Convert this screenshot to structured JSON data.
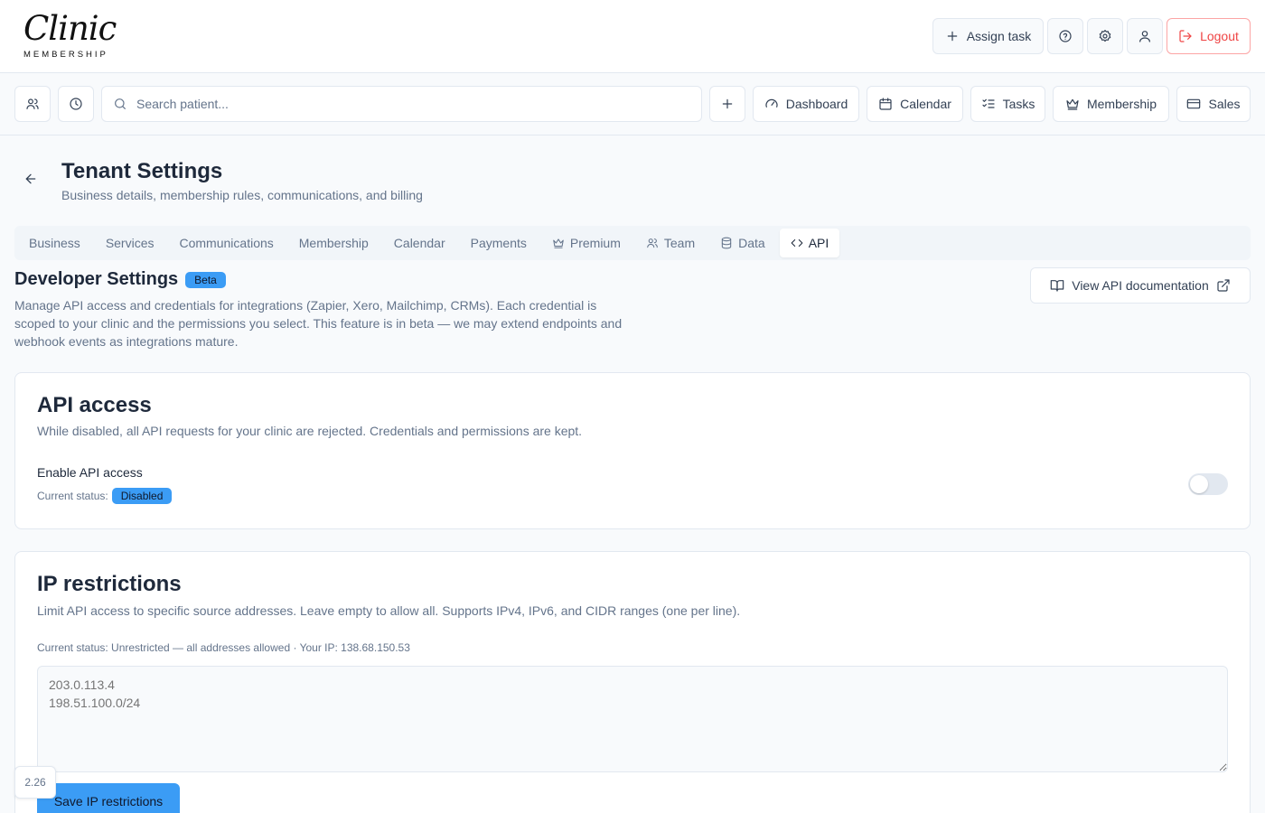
{
  "brand": {
    "logo_script": "Clinic",
    "logo_sub": "MEMBERSHIP"
  },
  "header": {
    "assign_task": "Assign task",
    "logout": "Logout",
    "icons": [
      "help-icon",
      "gear-icon",
      "user-icon",
      "logout-icon"
    ]
  },
  "nav": {
    "search_placeholder": "Search patient...",
    "items": [
      {
        "label": "Dashboard",
        "icon": "gauge-icon"
      },
      {
        "label": "Calendar",
        "icon": "calendar-icon"
      },
      {
        "label": "Tasks",
        "icon": "list-checks-icon"
      },
      {
        "label": "Membership",
        "icon": "crown-icon"
      },
      {
        "label": "Sales",
        "icon": "credit-card-icon"
      }
    ]
  },
  "page": {
    "title": "Tenant Settings",
    "subtitle": "Business details, membership rules, communications, and billing"
  },
  "tabs": [
    {
      "label": "Business"
    },
    {
      "label": "Services"
    },
    {
      "label": "Communications"
    },
    {
      "label": "Membership"
    },
    {
      "label": "Calendar"
    },
    {
      "label": "Payments"
    },
    {
      "label": "Premium",
      "icon": "crown-icon"
    },
    {
      "label": "Team",
      "icon": "users-icon"
    },
    {
      "label": "Data",
      "icon": "database-icon"
    },
    {
      "label": "API",
      "icon": "code-icon",
      "active": true
    }
  ],
  "developer": {
    "title": "Developer Settings",
    "badge": "Beta",
    "description": "Manage API access and credentials for integrations (Zapier, Xero, Mailchimp, CRMs). Each credential is scoped to your clinic and the permissions you select. This feature is in beta — we may extend endpoints and webhook events as integrations mature.",
    "doc_button": "View API documentation"
  },
  "api_access": {
    "title": "API access",
    "description": "While disabled, all API requests for your clinic are rejected. Credentials and permissions are kept.",
    "enable_label": "Enable API access",
    "status_label": "Current status:",
    "status_value": "Disabled",
    "enabled": false
  },
  "ip_restrictions": {
    "title": "IP restrictions",
    "description": "Limit API access to specific source addresses. Leave empty to allow all. Supports IPv4, IPv6, and CIDR ranges (one per line).",
    "status_line": "Current status: Unrestricted — all addresses allowed · Your IP: 138.68.150.53",
    "placeholder": "203.0.113.4\n198.51.100.0/24",
    "save_button": "Save IP restrictions"
  },
  "version": "2.26",
  "colors": {
    "accent": "#3b9cf5",
    "danger": "#ef4444",
    "border": "#e2e8f0",
    "muted": "#64748b"
  }
}
